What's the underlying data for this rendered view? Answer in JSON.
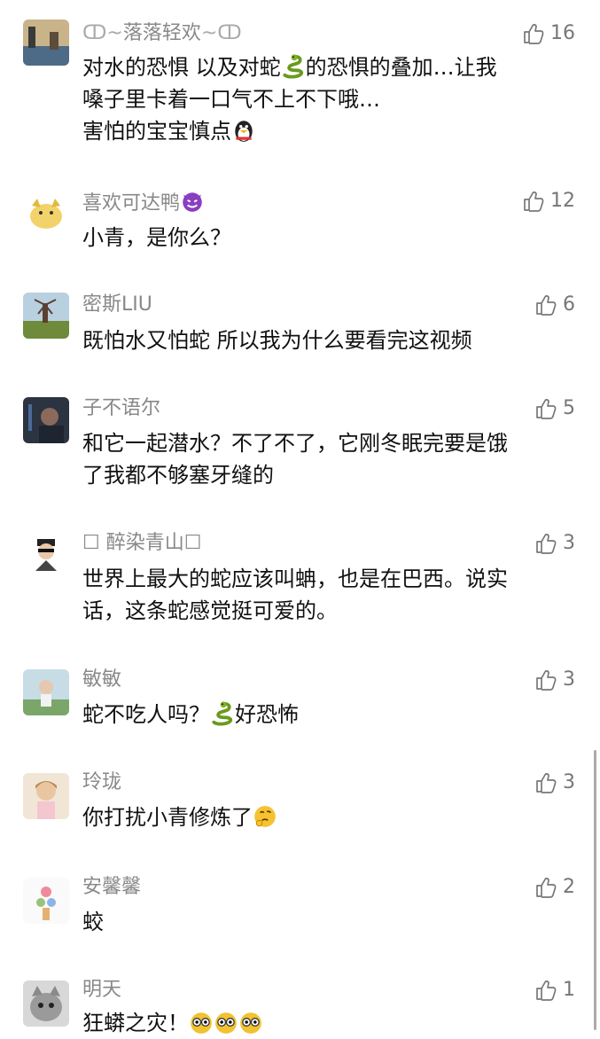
{
  "comments": [
    {
      "name": "落落轻欢",
      "likes": "16",
      "lines": [
        "对水的恐惧 以及对蛇",
        "的恐惧的叠加…让我",
        "嗓子里卡着一口气不上不下哦…",
        "害怕的宝宝慎点"
      ]
    },
    {
      "name": "喜欢可达鸭",
      "likes": "12",
      "lines": [
        "小青，是你么？"
      ]
    },
    {
      "name": "密斯LIU",
      "likes": "6",
      "lines": [
        "既怕水又怕蛇 所以我为什么要看完这视频"
      ]
    },
    {
      "name": "子不语尔",
      "likes": "5",
      "lines": [
        "和它一起潜水？不了不了，它刚冬眠完要是饿",
        "了我都不够塞牙缝的"
      ]
    },
    {
      "name": "☐ 醉染青山☐",
      "likes": "3",
      "lines": [
        "世界上最大的蛇应该叫蚺，也是在巴西。说实",
        "话，这条蛇感觉挺可爱的。"
      ]
    },
    {
      "name": "敏敏",
      "likes": "3",
      "lines": [
        "蛇不吃人吗？",
        "好恐怖"
      ]
    },
    {
      "name": "玲珑",
      "likes": "3",
      "lines": [
        "你打扰小青修炼了"
      ]
    },
    {
      "name": "安馨馨",
      "likes": "2",
      "lines": [
        "蛟"
      ]
    },
    {
      "name": "明天",
      "likes": "1",
      "lines": [
        "狂蟒之灾！"
      ]
    }
  ],
  "icons": {
    "like": "thumbs-up-icon",
    "snake": "snake-emoji-icon",
    "penguin": "penguin-emoji-icon",
    "devil": "devil-emoji-icon",
    "think": "thinking-emoji-icon",
    "eyes": "staring-eyes-emoji-icon"
  },
  "colors": {
    "name": "#888888",
    "text": "#111111",
    "like": "#777777"
  }
}
